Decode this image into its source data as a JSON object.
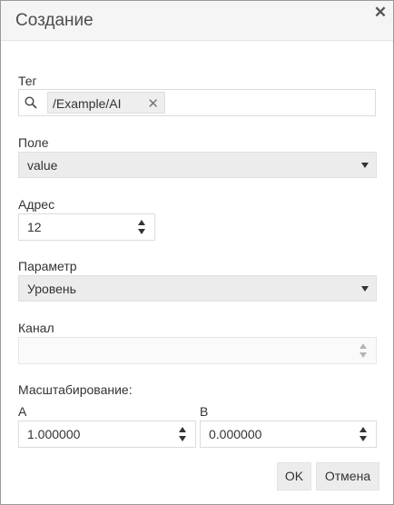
{
  "dialog": {
    "title": "Создание",
    "close_icon": "close-icon"
  },
  "tag": {
    "label": "Тег",
    "search_icon": "search-icon",
    "chip_text": "/Example/AI",
    "chip_remove_icon": "remove-icon"
  },
  "field": {
    "label": "Поле",
    "value": "value"
  },
  "address": {
    "label": "Адрес",
    "value": "12"
  },
  "parameter": {
    "label": "Параметр",
    "value": "Уровень"
  },
  "channel": {
    "label": "Канал",
    "value": ""
  },
  "scaling": {
    "label": "Масштабирование:",
    "a_label": "A",
    "a_value": "1.000000",
    "b_label": "B",
    "b_value": "0.000000"
  },
  "buttons": {
    "ok": "OK",
    "cancel": "Отмена"
  }
}
